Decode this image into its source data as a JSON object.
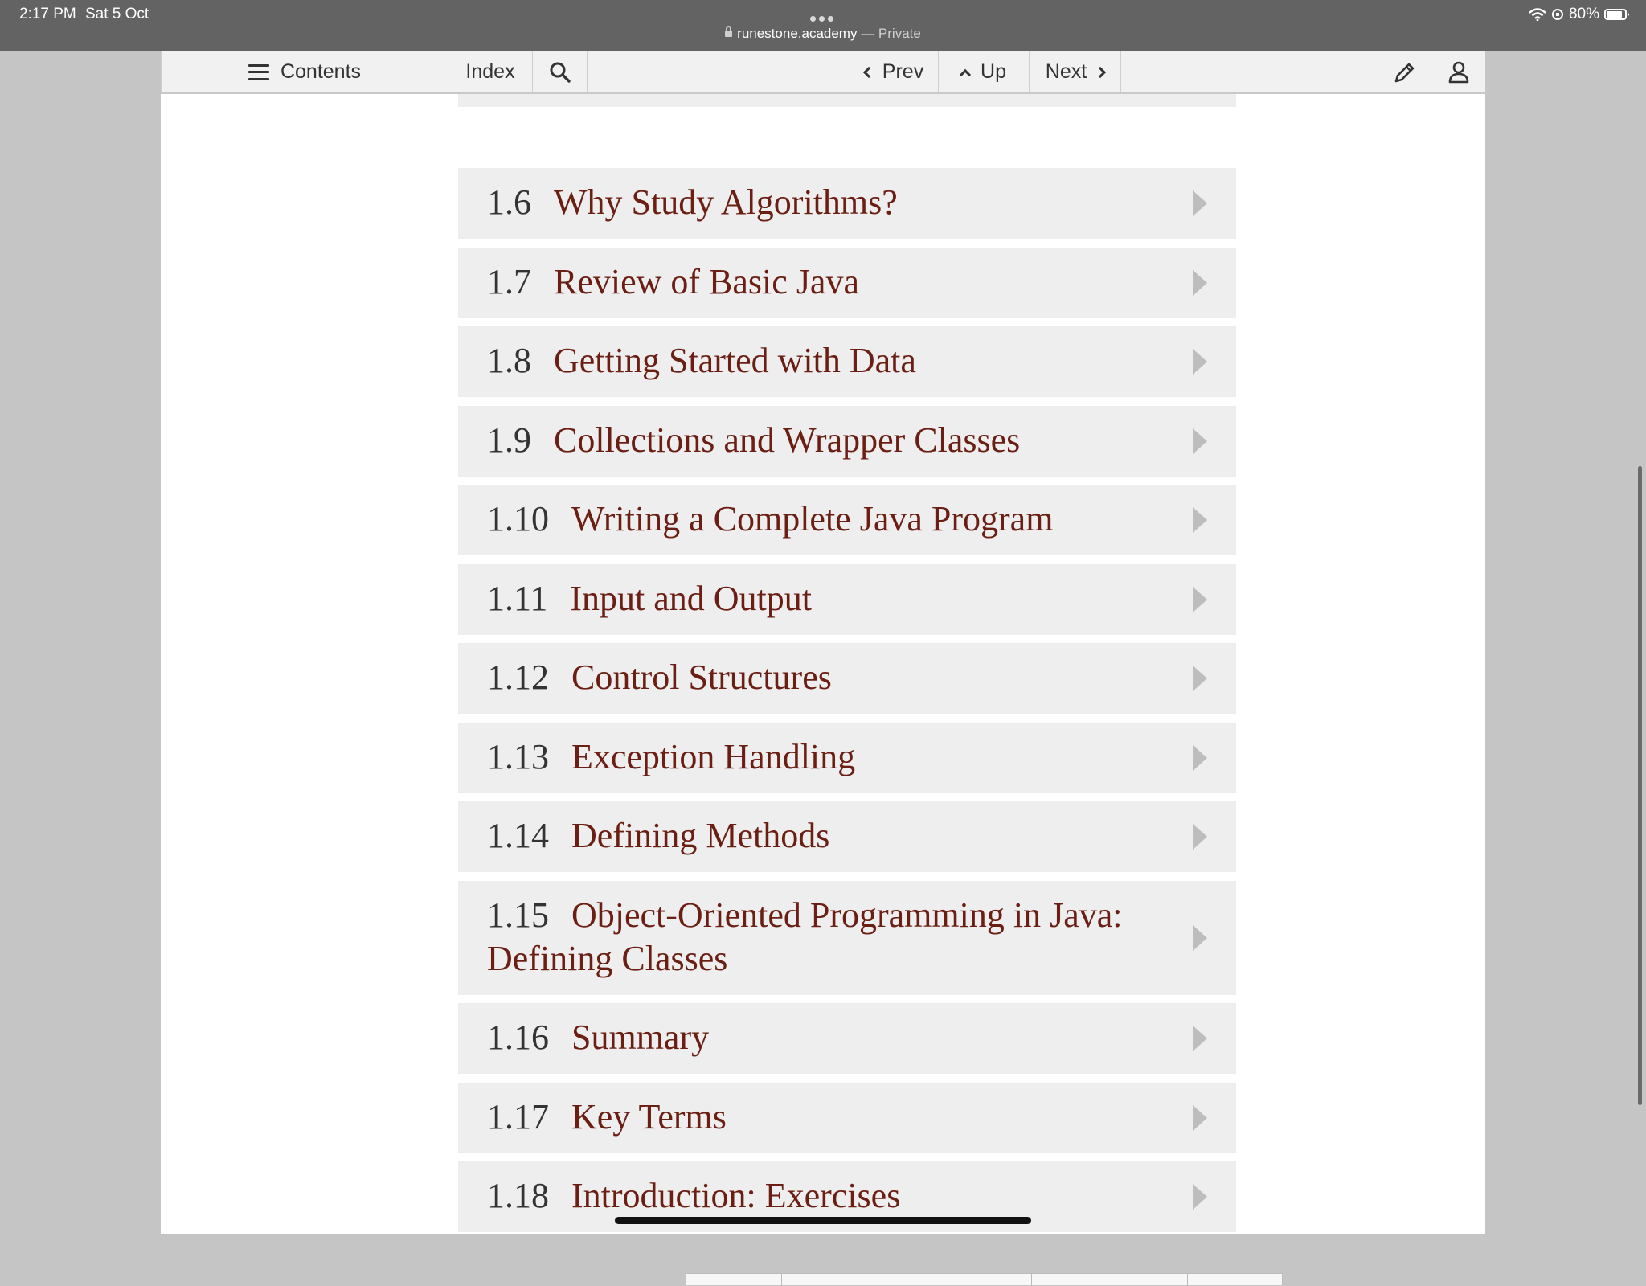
{
  "status": {
    "time": "2:17 PM",
    "date": "Sat 5 Oct",
    "battery": "80%",
    "url": "runestone.academy",
    "url_suffix": " — Private"
  },
  "toolbar": {
    "contents_label": "Contents",
    "index_label": "Index",
    "prev_label": "Prev",
    "up_label": "Up",
    "next_label": "Next"
  },
  "toc": {
    "items": [
      {
        "num": "1.6",
        "title": "Why Study Algorithms?"
      },
      {
        "num": "1.7",
        "title": "Review of Basic Java"
      },
      {
        "num": "1.8",
        "title": "Getting Started with Data"
      },
      {
        "num": "1.9",
        "title": "Collections and Wrapper Classes"
      },
      {
        "num": "1.10",
        "title": "Writing a Complete Java Program"
      },
      {
        "num": "1.11",
        "title": "Input and Output"
      },
      {
        "num": "1.12",
        "title": "Control Structures"
      },
      {
        "num": "1.13",
        "title": "Exception Handling"
      },
      {
        "num": "1.14",
        "title": "Defining Methods"
      },
      {
        "num": "1.15",
        "title": "Object-Oriented Programming in Java: Defining Classes"
      },
      {
        "num": "1.16",
        "title": "Summary"
      },
      {
        "num": "1.17",
        "title": "Key Terms"
      },
      {
        "num": "1.18",
        "title": "Introduction: Exercises"
      }
    ]
  }
}
